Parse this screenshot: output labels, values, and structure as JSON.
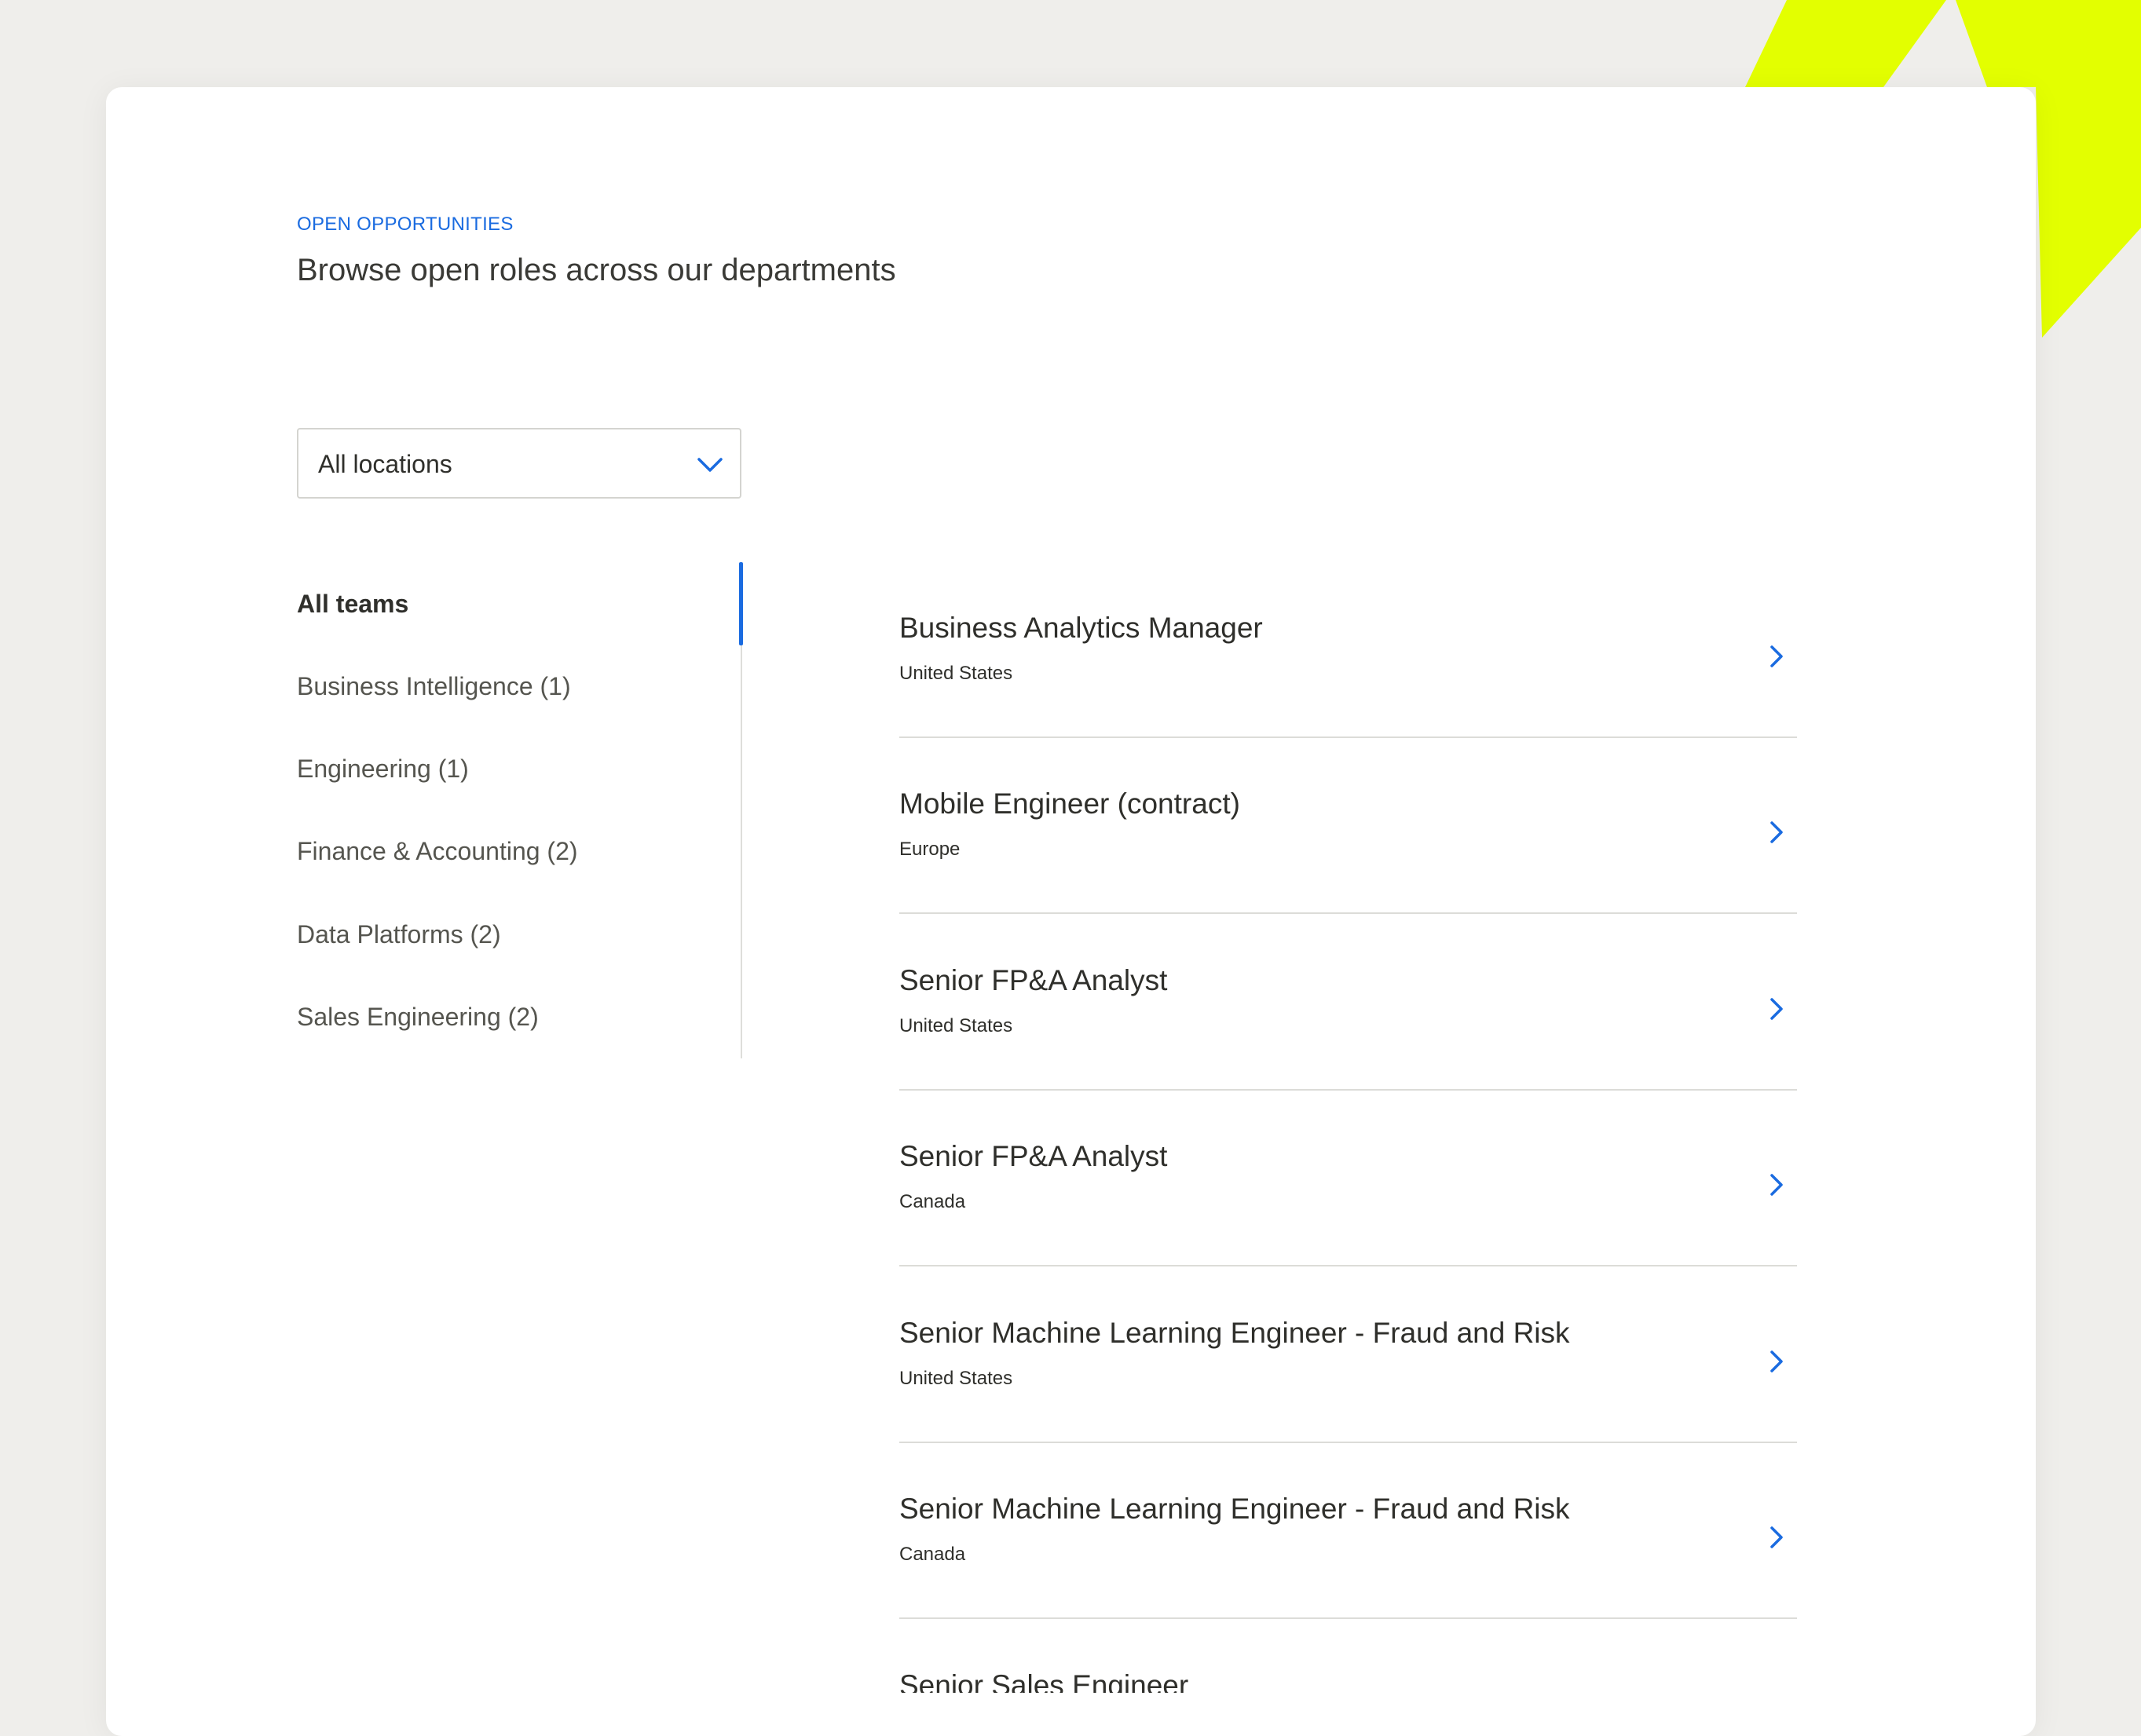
{
  "colors": {
    "accent": "#1a6be0",
    "highlight": "#e3ff00",
    "background": "#efeeeb",
    "card": "#ffffff"
  },
  "header": {
    "eyebrow": "OPEN OPPORTUNITIES",
    "title": "Browse open roles across our departments"
  },
  "filter": {
    "location_label": "All locations",
    "icon": "chevron-down-icon"
  },
  "teams": [
    {
      "label": "All teams",
      "active": true
    },
    {
      "label": "Business Intelligence (1)",
      "active": false
    },
    {
      "label": "Engineering (1)",
      "active": false
    },
    {
      "label": "Finance & Accounting (2)",
      "active": false
    },
    {
      "label": "Data Platforms (2)",
      "active": false
    },
    {
      "label": "Sales Engineering (2)",
      "active": false
    }
  ],
  "jobs": [
    {
      "title": "Business Analytics Manager",
      "location": "United States"
    },
    {
      "title": "Mobile Engineer (contract)",
      "location": "Europe"
    },
    {
      "title": "Senior FP&A Analyst",
      "location": "United States"
    },
    {
      "title": "Senior FP&A Analyst",
      "location": "Canada"
    },
    {
      "title": "Senior Machine Learning Engineer - Fraud and Risk",
      "location": "United States"
    },
    {
      "title": "Senior Machine Learning Engineer - Fraud and Risk",
      "location": "Canada"
    },
    {
      "title": "Senior Sales Engineer",
      "location": ""
    }
  ]
}
